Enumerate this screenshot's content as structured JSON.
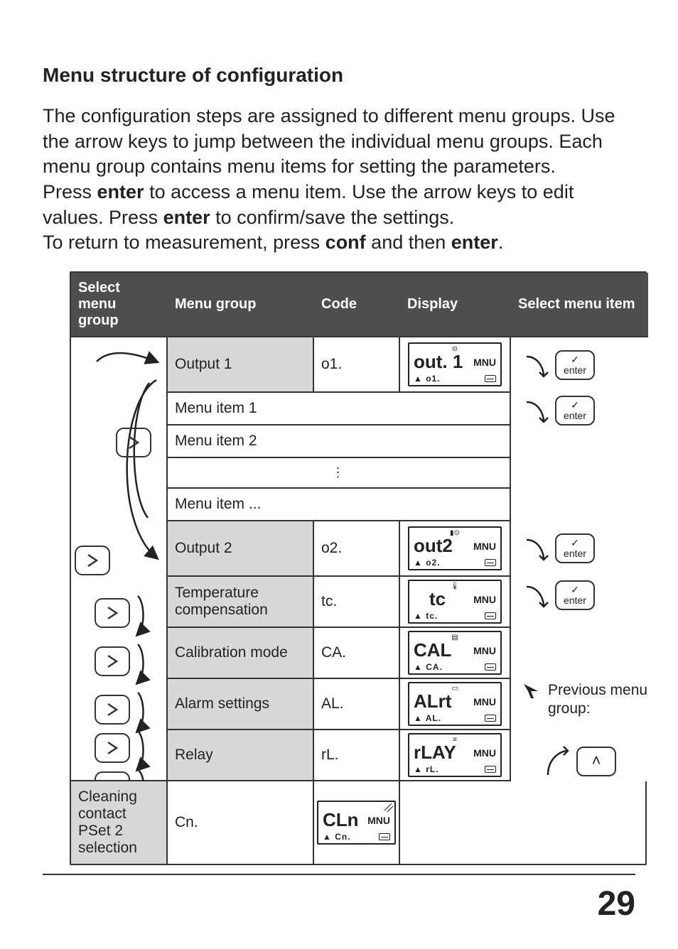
{
  "title": "Menu structure of configuration",
  "p1": "The configuration steps are assigned to different menu groups. Use the arrow keys to jump between the individual menu groups. Each menu group contains menu items for setting the parameters.",
  "p2a": "Press ",
  "p2b": " to access a menu item. Use the arrow keys to edit values. Press ",
  "p2c": " to confirm/save the settings.",
  "p3a": "To return to measurement, press ",
  "p3b": " and then ",
  "p3c": ".",
  "bold": {
    "enter": "enter",
    "conf": "conf"
  },
  "headers": {
    "select_group": "Select menu group",
    "menu_group": "Menu group",
    "code": "Code",
    "display": "Display",
    "select_item": "Select menu item"
  },
  "rows": {
    "o1": {
      "group": "Output 1",
      "code": "o1.",
      "disp_main": "out. 1",
      "disp_side": "MNU",
      "disp_bl": "▲  o1."
    },
    "mi1": "Menu item 1",
    "mi2": "Menu item 2",
    "mix": "Menu item ...",
    "o2": {
      "group": "Output 2",
      "code": "o2.",
      "disp_main": "out2",
      "disp_side": "MNU",
      "disp_bl": "▲  o2."
    },
    "tc": {
      "group": "Temperature compensation",
      "code": "tc.",
      "disp_main": "tc",
      "disp_side": "MNU",
      "disp_bl": "▲  tc."
    },
    "ca": {
      "group": "Calibration mode",
      "code": "CA.",
      "disp_main": "CAL",
      "disp_side": "MNU",
      "disp_bl": "▲  CA."
    },
    "al": {
      "group": "Alarm settings",
      "code": "AL.",
      "disp_main": "ALrt",
      "disp_side": "MNU",
      "disp_bl": "▲  AL."
    },
    "rl": {
      "group": "Relay",
      "code": "rL.",
      "disp_main": "rLAY",
      "disp_side": "MNU",
      "disp_bl": "▲  rL."
    },
    "cn": {
      "group": "Cleaning contact PSet 2 selection",
      "code": "Cn.",
      "disp_main": "CLn",
      "disp_side": "MNU",
      "disp_bl": "▲  Cn."
    }
  },
  "key": {
    "enter": "enter"
  },
  "prev": {
    "label": "Previous menu group:"
  },
  "page": "29"
}
